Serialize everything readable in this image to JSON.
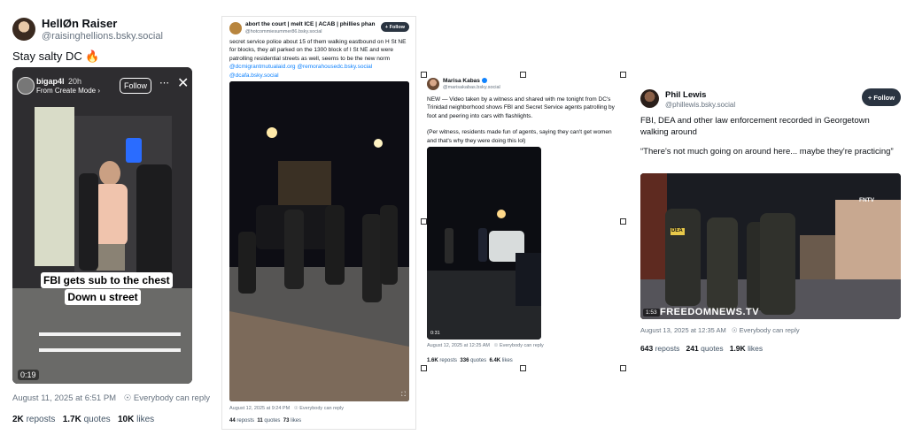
{
  "post1": {
    "name": "HellØn Raiser",
    "handle": "@raisinghellions.bsky.social",
    "text": "Stay salty DC 🔥",
    "story_user": "bigap4l",
    "story_time": "20h",
    "story_sub": "From Create Mode ›",
    "story_follow": "Follow",
    "caption_line1": "FBI gets sub to the chest",
    "caption_line2": "Down u street",
    "duration": "0:19",
    "date": "August 11, 2025 at 6:51 PM",
    "reply": "Everybody can reply",
    "reposts": "2K",
    "reposts_label": "reposts",
    "quotes": "1.7K",
    "quotes_label": "quotes",
    "likes": "10K",
    "likes_label": "likes"
  },
  "post2": {
    "name": "abort the court | melt ICE | ACAB | phillies phan",
    "handle": "@hotcommiesummer86.bsky.social",
    "follow": "+ Follow",
    "text": "secret service police about 15 of them walking eastbound on H St NE for blocks, they all parked on the 1300 block of I St NE and were patrolling residential streets as well, seems to be the new norm",
    "links": "@dcmigrantmutualaid.org @remorahousedc.bsky.social @dcafa.bsky.social",
    "date": "August 12, 2025 at 9:24 PM",
    "reply": "Everybody can reply",
    "reposts": "44",
    "reposts_label": "reposts",
    "quotes": "11",
    "quotes_label": "quotes",
    "likes": "73",
    "likes_label": "likes"
  },
  "post3": {
    "name": "Marisa Kabas",
    "handle": "@marisakabas.bsky.social",
    "text1": "NEW — Video taken by a witness and shared with me tonight from DC's Trinidad neighborhood shows FBI and Secret Service agents patrolling by foot and peering into cars with flashlights.",
    "text2": "(Per witness, residents made fun of agents, saying they can't get women and that's why they were doing this lol)",
    "duration": "0:31",
    "date": "August 12, 2025 at 12:25 AM",
    "reply": "Everybody can reply",
    "reposts": "1.6K",
    "reposts_label": "reposts",
    "quotes": "336",
    "quotes_label": "quotes",
    "likes": "6.4K",
    "likes_label": "likes"
  },
  "post4": {
    "name": "Phil Lewis",
    "handle": "@phillewis.bsky.social",
    "follow": "+ Follow",
    "text1": "FBI, DEA and other law enforcement recorded in Georgetown walking around",
    "text2": "“There's not much going on around here... maybe they're practicing”",
    "watermark": "FREEDOMNEWS.TV",
    "channel": "FNTV",
    "duration": "1:53",
    "vest_label": "DEA",
    "date": "August 13, 2025 at 12:35 AM",
    "reply": "Everybody can reply",
    "reposts": "643",
    "reposts_label": "reposts",
    "quotes": "241",
    "quotes_label": "quotes",
    "likes": "1.9K",
    "likes_label": "likes"
  }
}
